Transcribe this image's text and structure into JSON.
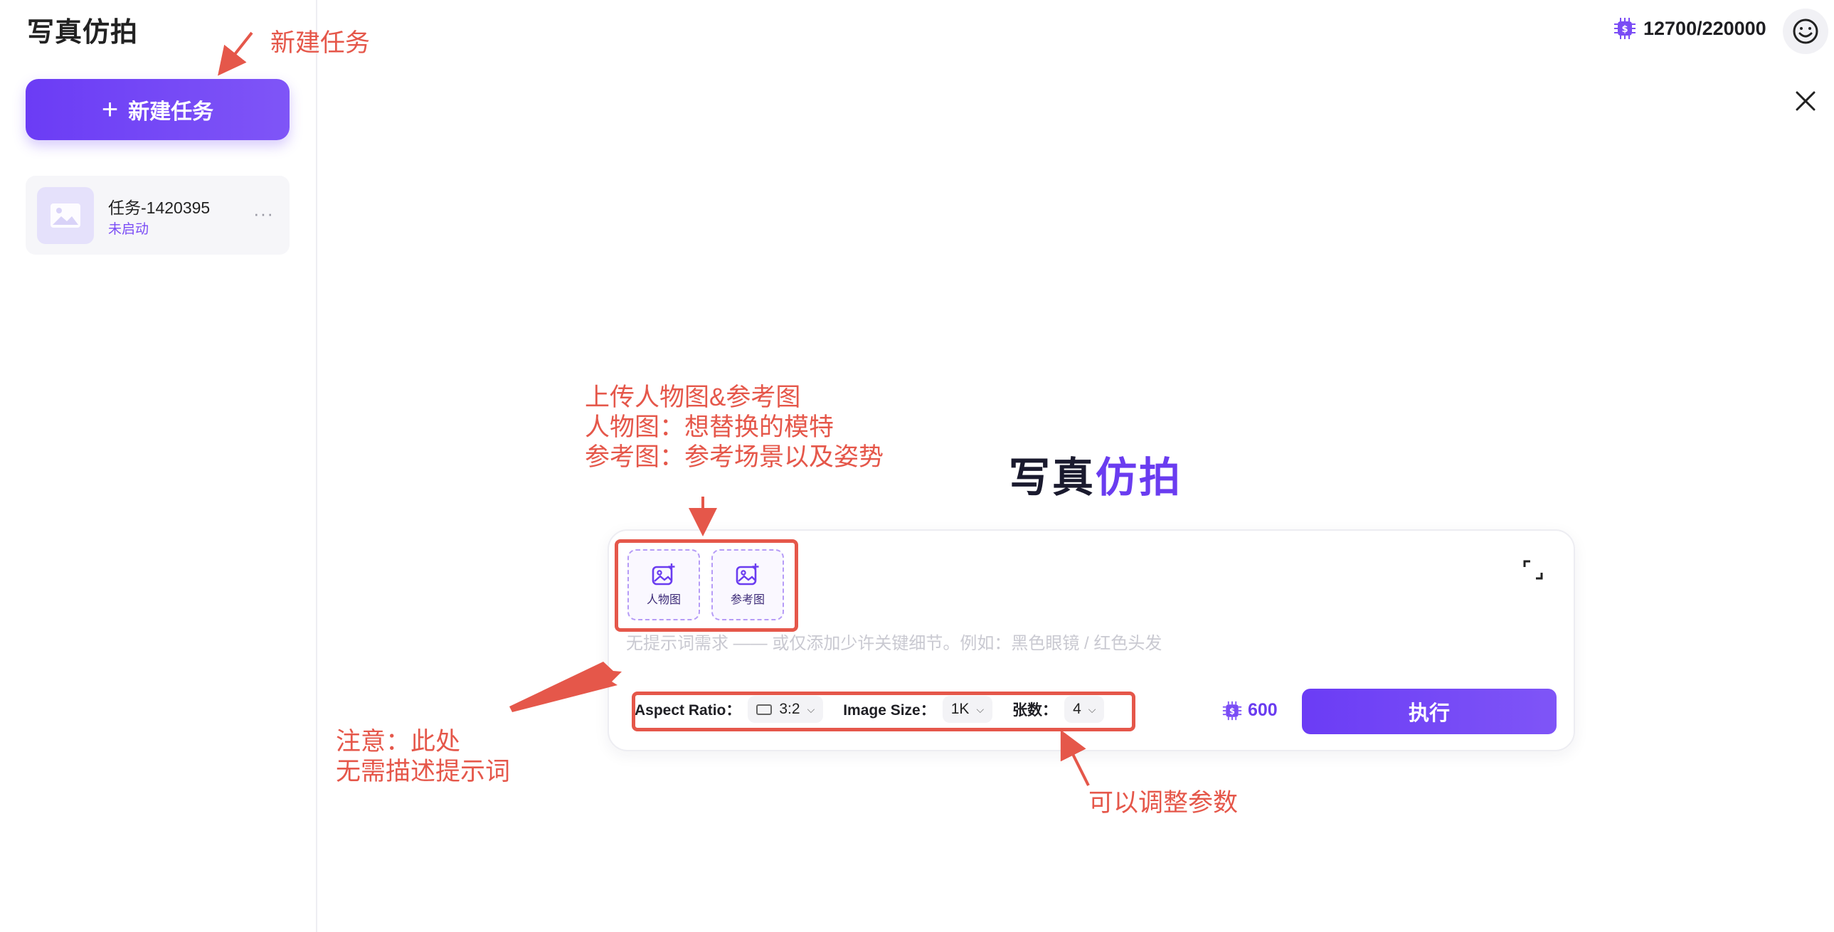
{
  "sidebar": {
    "app_title": "写真仿拍",
    "new_task_label": "新建任务",
    "tasks": [
      {
        "name": "任务-1420395",
        "status": "未启动",
        "more": "···"
      }
    ]
  },
  "header": {
    "credits": "12700/220000"
  },
  "main": {
    "title_part1": "写真",
    "title_part2": "仿拍",
    "upload_person_label": "人物图",
    "upload_ref_label": "参考图",
    "prompt_placeholder": "无提示词需求 —— 或仅添加少许关键细节。例如：黑色眼镜 / 红色头发",
    "prompt_value": "",
    "params": {
      "aspect_ratio_label": "Aspect Ratio：",
      "aspect_ratio_value": "3:2",
      "image_size_label": "Image Size：",
      "image_size_value": "1K",
      "count_label": "张数：",
      "count_value": "4"
    },
    "cost": "600",
    "run_label": "执行"
  },
  "annotations": {
    "new_task": "新建任务",
    "upload": "上传人物图&参考图\n人物图：想替换的模特\n参考图：参考场景以及姿势",
    "note": "注意：此处\n无需描述提示词",
    "params": "可以调整参数"
  },
  "colors": {
    "accent": "#6b3cf5",
    "annotation": "#e5574a"
  }
}
